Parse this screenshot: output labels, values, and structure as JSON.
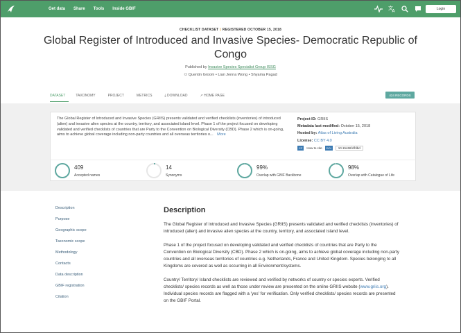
{
  "nav": {
    "links": [
      "Get data",
      "Share",
      "Tools",
      "Inside GBIF"
    ],
    "login_label": "Login",
    "icons": [
      "activity-icon",
      "translate-icon",
      "search-icon",
      "feedback-icon",
      "notifications-icon"
    ],
    "brand_color": "#4e9e6a"
  },
  "header": {
    "dataset_type": "CHECKLIST DATASET",
    "registered": "REGISTERED OCTOBER 15, 2018",
    "title": "Global Register of Introduced and Invasive Species- Democratic Republic of Congo",
    "published_by_prefix": "Published by",
    "publisher": "Invasive Species Specialist Group ISSG",
    "authors": "Quentin Groom • Lian Jenna Wong • Shyama Pagad"
  },
  "tabs": [
    "DATASET",
    "TAXONOMY",
    "PROJECT",
    "METRICS",
    "DOWNLOAD",
    "HOME PAGE"
  ],
  "records_badge": "424 RECORDS",
  "summary": {
    "description": "The Global Register of Introduced and Invasive Species (GRIIS) presents validated and verified checklists (inventories) of introduced (alien) and invasive alien species at the country, territory, and associated island level. Phase 1 of the project focused on developing validated and verified checklists of countries that are Party to the Convention on Biological Diversity (CBD). Phase 2 which is on-going, aims to achieve global coverage including non-party countries and all overseas territories o...",
    "more_label": "More",
    "project_id_label": "Project ID:",
    "project_id": "GRIIS",
    "metadata_label": "Metadata last modified:",
    "metadata_value": "October 15, 2018",
    "hosted_label": "Hosted by:",
    "hosted_value": "Atlas of Living Australia",
    "license_label": "License:",
    "license_value": "CC BY 4.0",
    "cite_icon": "CF",
    "cite_label": "How to cite",
    "doi_label": "DOI",
    "doi_value": "10.15468/cfblbd"
  },
  "stats": [
    {
      "value": "409",
      "label": "Accepted names",
      "fill": 1.0
    },
    {
      "value": "14",
      "label": "Synonyms",
      "fill": 0.03
    },
    {
      "value": "99%",
      "label": "Overlap with GBIF Backbone",
      "fill": 0.99
    },
    {
      "value": "98%",
      "label": "Overlap with Catalogue of Life",
      "fill": 0.98
    }
  ],
  "sidenav": [
    "Description",
    "Purpose",
    "Geographic scope",
    "Taxonomic scope",
    "Methodology",
    "Contacts",
    "Data description",
    "GBIF registration",
    "Citation"
  ],
  "description": {
    "title": "Description",
    "p1": "The Global Register of Introduced and Invasive Species (GRIIS) presents validated and verified checklists (inventories) of introduced (alien) and invasive alien species at the country, territory, and associated island level.",
    "p2": "Phase 1 of the project focused on developing validated and verified checklists of countries that are Party to the Convention on Biological Diversity (CBD). Phase 2 which is on-going, aims to achieve global coverage including non-party countries and all overseas territories of countries e.g. Netherlands, France and United Kingdom. Species belonging to all Kingdoms are covered as well as occurring in all Environment/systems.",
    "p3_a": "Country/ Territory/ Island checklists are reviewed and verified by networks of country or species experts. Verified checklists/ species records as well as those under review are presented on the online GRIIS website (",
    "p3_link": "www.griis.org",
    "p3_b": "). Individual species records are flagged with a 'yes' for verification. Only verified checklists/ species records are presented on the GBIF Portal."
  }
}
